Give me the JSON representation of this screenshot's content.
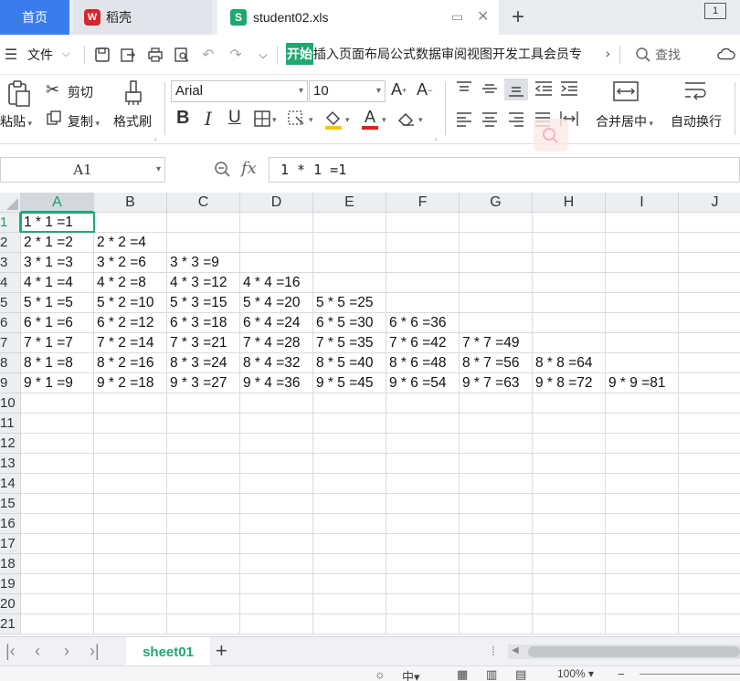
{
  "tabs": {
    "home": "首页",
    "wk": "稻壳",
    "wk_logo": "W",
    "doc_title": "student02.xls",
    "doc_icon": "S",
    "badge": "1"
  },
  "menu": {
    "file": "文件",
    "active_tab": "开始",
    "tabs": [
      "插入",
      "页面布局",
      "公式",
      "数据",
      "审阅",
      "视图",
      "开发工具",
      "会员专"
    ],
    "more": "›",
    "search": "查找"
  },
  "toolbar": {
    "paste": "粘贴",
    "cut": "剪切",
    "copy": "复制",
    "format_painter": "格式刷",
    "font_name": "Arial",
    "font_size": "10",
    "merge_center": "合并居中",
    "wrap_text": "自动换行"
  },
  "formula_bar": {
    "name_box": "A1",
    "fx_label": "fx",
    "formula": "1 * 1 =1"
  },
  "grid": {
    "columns": [
      "A",
      "B",
      "C",
      "D",
      "E",
      "F",
      "G",
      "H",
      "I",
      "J"
    ],
    "rows": [
      "1",
      "2",
      "3",
      "4",
      "5",
      "6",
      "7",
      "8",
      "9",
      "10",
      "11",
      "12",
      "13",
      "14",
      "15",
      "16",
      "17",
      "18",
      "19",
      "20",
      "21"
    ],
    "cells": [
      [
        "1 * 1 =1"
      ],
      [
        "2 * 1 =2",
        "2 * 2 =4"
      ],
      [
        "3 * 1 =3",
        "3 * 2 =6",
        "3 * 3 =9"
      ],
      [
        "4 * 1 =4",
        "4 * 2 =8",
        "4 * 3 =12",
        "4 * 4 =16"
      ],
      [
        "5 * 1 =5",
        "5 * 2 =10",
        "5 * 3 =15",
        "5 * 4 =20",
        "5 * 5 =25"
      ],
      [
        "6 * 1 =6",
        "6 * 2 =12",
        "6 * 3 =18",
        "6 * 4 =24",
        "6 * 5 =30",
        "6 * 6 =36"
      ],
      [
        "7 * 1 =7",
        "7 * 2 =14",
        "7 * 3 =21",
        "7 * 4 =28",
        "7 * 5 =35",
        "7 * 6 =42",
        "7 * 7 =49"
      ],
      [
        "8 * 1 =8",
        "8 * 2 =16",
        "8 * 3 =24",
        "8 * 4 =32",
        "8 * 5 =40",
        "8 * 6 =48",
        "8 * 7 =56",
        "8 * 8 =64"
      ],
      [
        "9 * 1 =9",
        "9 * 2 =18",
        "9 * 3 =27",
        "9 * 4 =36",
        "9 * 5 =45",
        "9 * 6 =54",
        "9 * 7 =63",
        "9 * 8 =72",
        "9 * 9 =81"
      ]
    ]
  },
  "sheets": {
    "active": "sheet01"
  },
  "status": {
    "zoom": "100%"
  },
  "colors": {
    "accent": "#1fa96f",
    "home_tab": "#3a7cf0"
  }
}
